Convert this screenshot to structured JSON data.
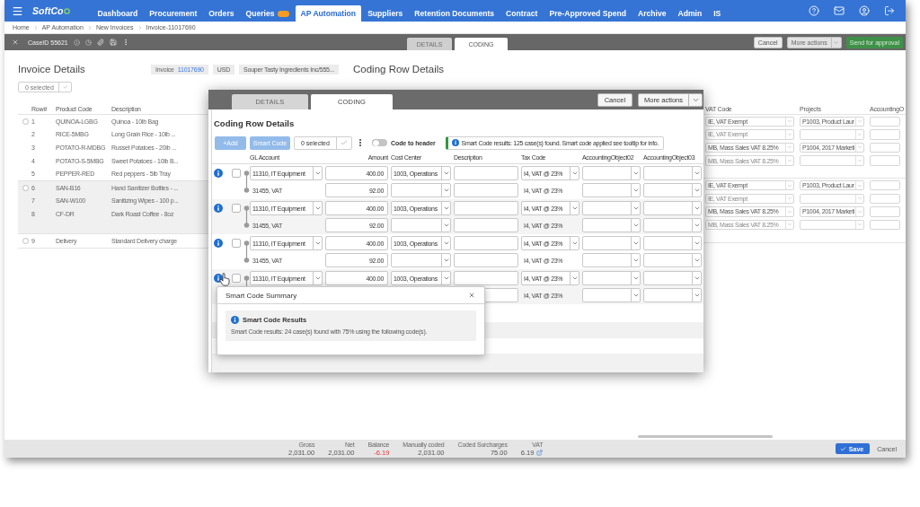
{
  "nav": {
    "logo": "SoftCo",
    "items": [
      {
        "label": "Dashboard",
        "selected": false,
        "badge": false
      },
      {
        "label": "Procurement",
        "selected": false,
        "badge": false
      },
      {
        "label": "Orders",
        "selected": false,
        "badge": false
      },
      {
        "label": "Queries",
        "selected": false,
        "badge": true
      },
      {
        "label": "AP Automation",
        "selected": true,
        "badge": false
      },
      {
        "label": "Suppliers",
        "selected": false,
        "badge": false
      },
      {
        "label": "Retention Documents",
        "selected": false,
        "badge": false
      },
      {
        "label": "Contract",
        "selected": false,
        "badge": false
      },
      {
        "label": "Pre-Approved Spend",
        "selected": false,
        "badge": false
      },
      {
        "label": "Archive",
        "selected": false,
        "badge": false
      },
      {
        "label": "Admin",
        "selected": false,
        "badge": false
      },
      {
        "label": "IS",
        "selected": false,
        "badge": false
      }
    ]
  },
  "breadcrumb": [
    "Home",
    "AP Automation",
    "New Invoices",
    "Invoice-11017690"
  ],
  "case_bar": {
    "case_id": "CaseID 55621",
    "tabs": [
      {
        "label": "DETAILS",
        "selected": false
      },
      {
        "label": "CODING",
        "selected": true
      }
    ],
    "cancel": "Cancel",
    "more_actions": "More actions",
    "send": "Send for approval"
  },
  "invoice_panel": {
    "title": "Invoice Details",
    "invoice_label": "Invoice",
    "invoice_number": "11017690",
    "currency": "USD",
    "supplier": "Souper Tasty Ingredients Inc/555...",
    "selection": "0 selected",
    "columns": [
      "Row#",
      "Product Code",
      "Description"
    ],
    "groups": [
      {
        "checked": false,
        "highlighted": false,
        "rows": [
          {
            "row": "1",
            "product_code": "QUINOA-LGBG",
            "description": "Quinoa - 10lb Bag"
          },
          {
            "row": "2",
            "product_code": "RICE-5MBG",
            "description": "Long Grain Rice - 10lb ..."
          },
          {
            "row": "3",
            "product_code": "POTATO-R-MDBG",
            "description": "Russet Potatoes - 20lb ..."
          },
          {
            "row": "4",
            "product_code": "POTATO-S-5MBG",
            "description": "Sweet Potatoes - 10lb B..."
          },
          {
            "row": "5",
            "product_code": "PEPPER-RED",
            "description": "Red peppers - 5lb Tray"
          }
        ]
      },
      {
        "checked": false,
        "highlighted": true,
        "rows": [
          {
            "row": "6",
            "product_code": "SAN-B16",
            "description": "Hand Sanitizer Bottles - ..."
          },
          {
            "row": "7",
            "product_code": "SAN-W100",
            "description": "Sanitizing Wipes - 100 p..."
          },
          {
            "row": "8",
            "product_code": "CF-DR",
            "description": "Dark Roast Coffee - 8oz"
          }
        ]
      },
      {
        "checked": false,
        "highlighted": false,
        "rows": [
          {
            "row": "9",
            "product_code": "Delivery",
            "description": "Standard Delivery charge"
          }
        ]
      }
    ]
  },
  "coding_panel": {
    "title": "Coding Row Details",
    "columns": [
      "VAT Code",
      "Projects",
      "AccountingO"
    ],
    "groups": [
      {
        "rows": [
          {
            "vat_code": "IE, VAT Exempt",
            "project": "P1003, Product Laur",
            "disabled": false
          },
          {
            "vat_code": "IE, VAT Exempt",
            "disabled": true
          },
          {
            "vat_code": "MB, Mass Sales VAT 8.25%",
            "project": "P1004, 2017 Marketi",
            "disabled": false
          },
          {
            "vat_code": "MB, Mass Sales VAT 8.25%",
            "disabled": true
          }
        ]
      },
      {
        "rows": [
          {
            "vat_code": "IE, VAT Exempt",
            "project": "P1003, Product Laur",
            "disabled": false
          },
          {
            "vat_code": "IE, VAT Exempt",
            "disabled": true
          },
          {
            "vat_code": "MB, Mass Sales VAT 8.25%",
            "project": "P1004, 2017 Marketi",
            "disabled": false
          },
          {
            "vat_code": "MB, Mass Sales VAT 8.25%",
            "disabled": true
          }
        ]
      }
    ]
  },
  "modal": {
    "tabs": [
      {
        "label": "DETAILS",
        "selected": false
      },
      {
        "label": "CODING",
        "selected": true
      }
    ],
    "cancel": "Cancel",
    "more_actions": "More actions",
    "title": "Coding Row Details",
    "add": "+Add",
    "smart_code": "Smart Code",
    "selection": "0 selected",
    "toggle": {
      "label": "Code to header",
      "on": false
    },
    "notice": "Smart Code results: 125 case(s) found. Smart code applied see tooltip for info.",
    "columns": [
      "GL Account",
      "Amount",
      "Cost Center",
      "Description",
      "Tax Code",
      "AccountingObject02",
      "AccountingObject03"
    ],
    "groups": [
      {
        "checked": false,
        "lines": [
          {
            "kind": "item",
            "gl_account": "11310, IT Equipment",
            "amount": "400.00",
            "cost_center": "1003, Operations",
            "tax_code": "I4, VAT @ 23%"
          },
          {
            "kind": "vat",
            "gl_account": "31455, VAT",
            "amount": "92.00",
            "tax_code": "I4, VAT @ 23%"
          }
        ]
      },
      {
        "checked": false,
        "lines": [
          {
            "kind": "item",
            "gl_account": "11310, IT Equipment",
            "amount": "400.00",
            "cost_center": "1003, Operations",
            "tax_code": "I4, VAT @ 23%"
          },
          {
            "kind": "vat",
            "gl_account": "31455, VAT",
            "amount": "92.00",
            "tax_code": "I4, VAT @ 23%"
          }
        ]
      },
      {
        "checked": false,
        "lines": [
          {
            "kind": "item",
            "gl_account": "11310, IT Equipment",
            "amount": "400.00",
            "cost_center": "1003, Operations",
            "tax_code": "I4, VAT @ 23%"
          },
          {
            "kind": "vat",
            "gl_account": "31455, VAT",
            "amount": "92.00",
            "tax_code": "I4, VAT @ 23%"
          }
        ]
      },
      {
        "checked": false,
        "lines": [
          {
            "kind": "item",
            "gl_account": "11310, IT Equipment",
            "amount": "400.00",
            "cost_center": "1003, Operations",
            "tax_code": "I4, VAT @ 23%"
          },
          {
            "kind": "vat",
            "tax_code": "I4, VAT @ 23%"
          }
        ]
      }
    ],
    "popup": {
      "title": "Smart Code Summary",
      "heading": "Smart Code Results",
      "text": "Smart Code results: 24 case(s) found with 75% using the following code(s)."
    }
  },
  "totals": [
    {
      "label": "Gross",
      "value": "2,031.00",
      "negative": false,
      "kind": "plain"
    },
    {
      "label": "Net",
      "value": "2,031.00",
      "negative": false,
      "kind": "plain"
    },
    {
      "label": "Balance",
      "value": "-6.19",
      "negative": true,
      "kind": "plain"
    },
    {
      "label": "Manually coded",
      "value": "2,031.00",
      "negative": false,
      "kind": "plain"
    },
    {
      "label": "Coded Surcharges",
      "value": "75.00",
      "negative": false,
      "kind": "plain"
    },
    {
      "label": "VAT",
      "value": "6.19",
      "negative": false,
      "kind": "link"
    }
  ],
  "footer": {
    "save": "Save",
    "cancel": "Cancel"
  }
}
